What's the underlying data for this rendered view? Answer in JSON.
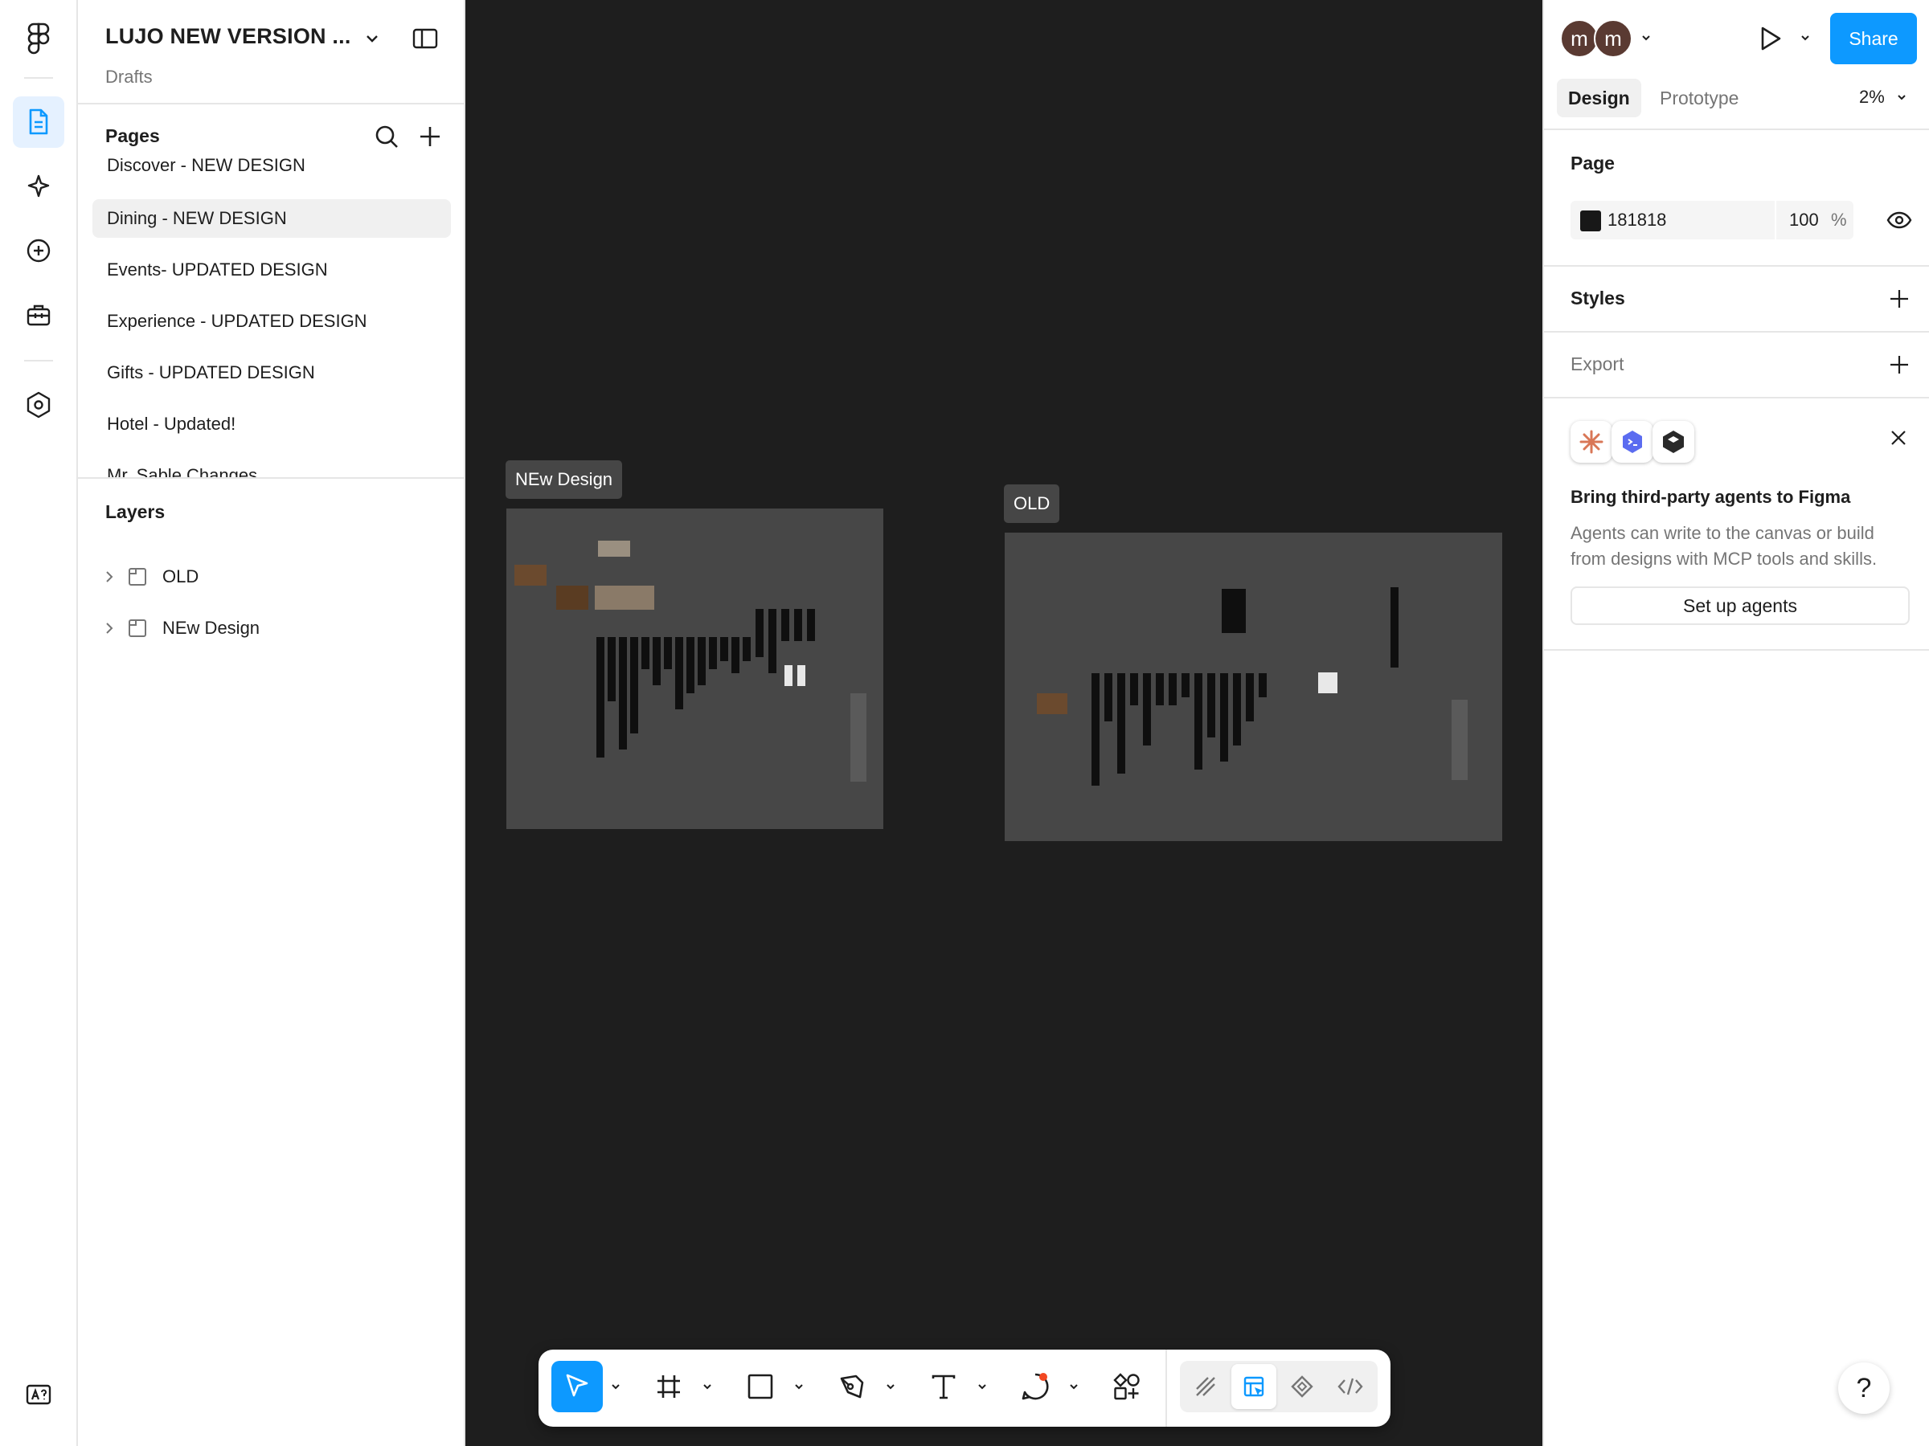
{
  "file": {
    "title": "LUJO NEW VERSION ...",
    "location": "Drafts"
  },
  "pages": {
    "heading": "Pages",
    "items": [
      {
        "label": "Discover - NEW DESIGN"
      },
      {
        "label": "Dining - NEW DESIGN",
        "selected": true
      },
      {
        "label": "Events- UPDATED DESIGN"
      },
      {
        "label": "Experience - UPDATED DESIGN"
      },
      {
        "label": "Gifts - UPDATED DESIGN"
      },
      {
        "label": "Hotel - Updated!"
      },
      {
        "label": "Mr. Sable Changes"
      }
    ]
  },
  "layers": {
    "heading": "Layers",
    "items": [
      {
        "label": "OLD"
      },
      {
        "label": "NEw Design"
      }
    ]
  },
  "canvas": {
    "background": "#1e1e1e",
    "frames": [
      {
        "label": "NEw Design"
      },
      {
        "label": "OLD"
      }
    ]
  },
  "toolbar": {
    "tools": [
      {
        "icon": "move-cursor-icon",
        "active": true
      },
      {
        "icon": "frame-hash-icon"
      },
      {
        "icon": "rectangle-icon"
      },
      {
        "icon": "pen-icon"
      },
      {
        "icon": "text-icon"
      },
      {
        "icon": "comment-icon"
      },
      {
        "icon": "actions-icon"
      }
    ],
    "modes": [
      {
        "icon": "draw-mode-icon"
      },
      {
        "icon": "design-mode-icon",
        "active": true
      },
      {
        "icon": "dev-handoff-icon"
      },
      {
        "icon": "code-icon"
      }
    ]
  },
  "right": {
    "avatars": [
      "m",
      "m"
    ],
    "share_label": "Share",
    "tabs": {
      "design": "Design",
      "prototype": "Prototype"
    },
    "zoom": "2%",
    "page_section": {
      "heading": "Page",
      "color_hex": "181818",
      "color_swatch": "#181818",
      "opacity": "100",
      "opacity_unit": "%"
    },
    "styles_heading": "Styles",
    "export_heading": "Export",
    "agents_card": {
      "title": "Bring third-party agents to Figma",
      "description": "Agents can write to the canvas or build from designs with MCP tools and skills.",
      "button_label": "Set up agents"
    },
    "help_label": "?"
  },
  "colors": {
    "accent": "#0d99ff",
    "selected_tab": "#e5f1ff"
  }
}
